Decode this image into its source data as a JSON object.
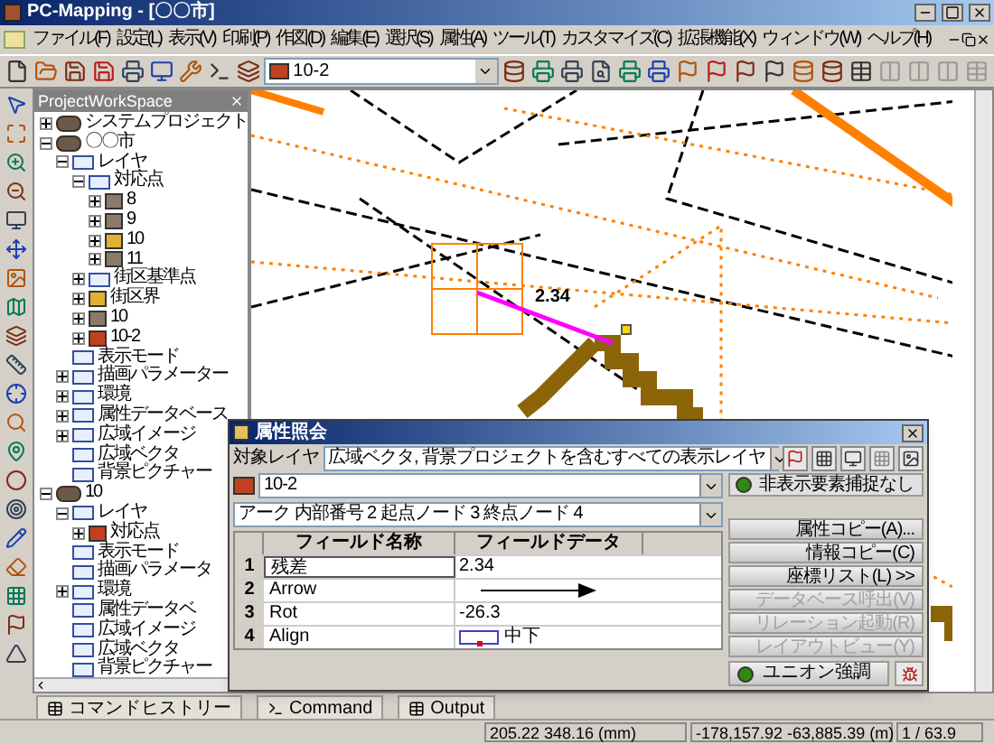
{
  "window": {
    "title": "PC-Mapping - [〇〇市]"
  },
  "menu": [
    "ファイル(F)",
    "設定(L)",
    "表示(V)",
    "印刷(P)",
    "作図(D)",
    "編集(E)",
    "選択(S)",
    "属性(A)",
    "ツール(T)",
    "カスタマイズ(C)",
    "拡張機能(X)",
    "ウィンドウ(W)",
    "ヘルプ(H)"
  ],
  "toolbar": {
    "layer_combo": "10-2"
  },
  "workspace": {
    "title": "ProjectWorkSpace",
    "tree": [
      {
        "label": "システムプロジェクト",
        "kind": "project",
        "expanded": false
      },
      {
        "label": "〇〇市",
        "kind": "project",
        "expanded": true,
        "children": [
          {
            "label": "レイヤ",
            "kind": "folder",
            "expanded": true,
            "children": [
              {
                "label": "対応点",
                "kind": "folder",
                "expanded": true,
                "children": [
                  {
                    "label": "8",
                    "kind": "layer",
                    "color": "#8a7a6a",
                    "expanded": false
                  },
                  {
                    "label": "9",
                    "kind": "layer",
                    "color": "#8a7a6a",
                    "expanded": false
                  },
                  {
                    "label": "10",
                    "kind": "layer",
                    "color": "#e0b030",
                    "expanded": false
                  },
                  {
                    "label": "11",
                    "kind": "layer",
                    "color": "#8a7a6a",
                    "expanded": false
                  }
                ]
              },
              {
                "label": "街区基準点",
                "kind": "folder",
                "expanded": false
              },
              {
                "label": "街区界",
                "kind": "layer",
                "color": "#e0b030",
                "expanded": false
              },
              {
                "label": "10",
                "kind": "layer",
                "color": "#8a7a6a",
                "expanded": false
              },
              {
                "label": "10-2",
                "kind": "layer",
                "color": "#c04020",
                "expanded": false
              }
            ]
          },
          {
            "label": "表示モード",
            "kind": "folder"
          },
          {
            "label": "描画パラメーター",
            "kind": "folder",
            "expanded": false
          },
          {
            "label": "環境",
            "kind": "folder",
            "expanded": false
          },
          {
            "label": "属性データベース",
            "kind": "folder",
            "expanded": false
          },
          {
            "label": "広域イメージ",
            "kind": "folder",
            "expanded": false
          },
          {
            "label": "広域ベクタ",
            "kind": "folder"
          },
          {
            "label": "背景ピクチャー",
            "kind": "folder"
          }
        ]
      },
      {
        "label": "10",
        "kind": "project",
        "expanded": true,
        "children": [
          {
            "label": "レイヤ",
            "kind": "folder",
            "expanded": true,
            "children": [
              {
                "label": "対応点",
                "kind": "layer",
                "color": "#c04020",
                "expanded": false
              }
            ]
          },
          {
            "label": "表示モード",
            "kind": "folder"
          },
          {
            "label": "描画パラメータ",
            "kind": "folder"
          },
          {
            "label": "環境",
            "kind": "folder",
            "expanded": false
          },
          {
            "label": "属性データベ",
            "kind": "folder"
          },
          {
            "label": "広域イメージ",
            "kind": "folder"
          },
          {
            "label": "広域ベクタ",
            "kind": "folder"
          },
          {
            "label": "背景ピクチャー",
            "kind": "folder"
          }
        ]
      }
    ]
  },
  "map": {
    "label": "2.34"
  },
  "dialog": {
    "title": "属性照会",
    "target_label": "対象レイヤ",
    "target_layer": "広域ベクタ, 背景プロジェクトを含むすべての表示レイヤ",
    "layer": "10-2",
    "hidden_toggle": {
      "label": "非表示要素捕捉なし",
      "on": true
    },
    "element": "アーク 内部番号 2 起点ノード 3 終点ノード 4",
    "columns": [
      "フィールド名称",
      "フィールドデータ"
    ],
    "rows": [
      {
        "no": "1",
        "name": "残差",
        "kind": "text",
        "value": "2.34",
        "selected": true
      },
      {
        "no": "2",
        "name": "Arrow",
        "kind": "arrow",
        "selected": false
      },
      {
        "no": "3",
        "name": "Rot",
        "kind": "text",
        "value": "-26.3",
        "selected": false
      },
      {
        "no": "4",
        "name": "Align",
        "kind": "align",
        "value": "中下",
        "selected": false
      }
    ],
    "buttons": [
      {
        "label": "属性コピー(A)...",
        "disabled": false
      },
      {
        "label": "情報コピー(C)",
        "disabled": false
      },
      {
        "label": "座標リスト(L) >>",
        "disabled": false
      },
      {
        "label": "データベース呼出(V)",
        "disabled": true
      },
      {
        "label": "リレーション起動(R)",
        "disabled": true
      },
      {
        "label": "レイアウトビュー(Y)",
        "disabled": true
      }
    ],
    "union": {
      "label": "ユニオン強調",
      "on": true
    }
  },
  "bottom_tabs": [
    "コマンドヒストリー",
    "Command",
    "Output"
  ],
  "status_bar": [
    "205.22 348.16 (mm)",
    "-178,157.92 -63,885.39 (m)",
    "1 / 63.9"
  ]
}
